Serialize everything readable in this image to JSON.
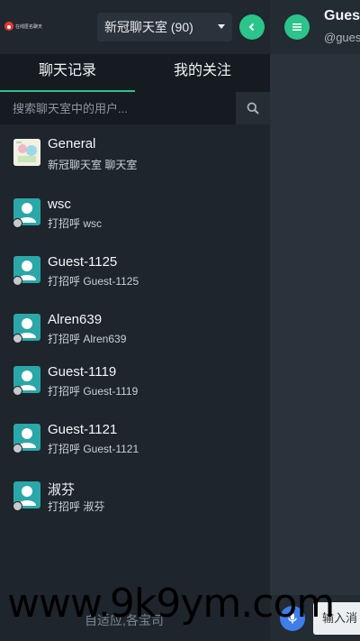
{
  "brand": {
    "logo_text": "在线匿名聊天"
  },
  "header": {
    "room_select": "新冠聊天室 (90)"
  },
  "tabs": [
    "聊天记录",
    "我的关注"
  ],
  "search": {
    "placeholder": "搜索聊天室中的用户..."
  },
  "chats": [
    {
      "name": "General",
      "sub": "新冠聊天室 聊天室",
      "type": "group"
    },
    {
      "name": "wsc",
      "sub": "打招呼 wsc",
      "type": "user"
    },
    {
      "name": "Guest-1125",
      "sub": "打招呼 Guest-1125",
      "type": "user"
    },
    {
      "name": "Alren639",
      "sub": "打招呼 Alren639",
      "type": "user"
    },
    {
      "name": "Guest-1119",
      "sub": "打招呼 Guest-1119",
      "type": "user"
    },
    {
      "name": "Guest-1121",
      "sub": "打招呼 Guest-1121",
      "type": "user"
    },
    {
      "name": "淑芬",
      "sub": "打招呼 淑芬",
      "type": "user"
    }
  ],
  "bottom_note": "自适应,各宝司",
  "main": {
    "title": "Gues",
    "subtitle": "@gues",
    "input_placeholder": "输入消"
  },
  "watermark": "www.9k9ym.com",
  "colors": {
    "accent": "#2bc48a",
    "avatar": "#2aa7a8",
    "mic": "#3f7de8"
  }
}
